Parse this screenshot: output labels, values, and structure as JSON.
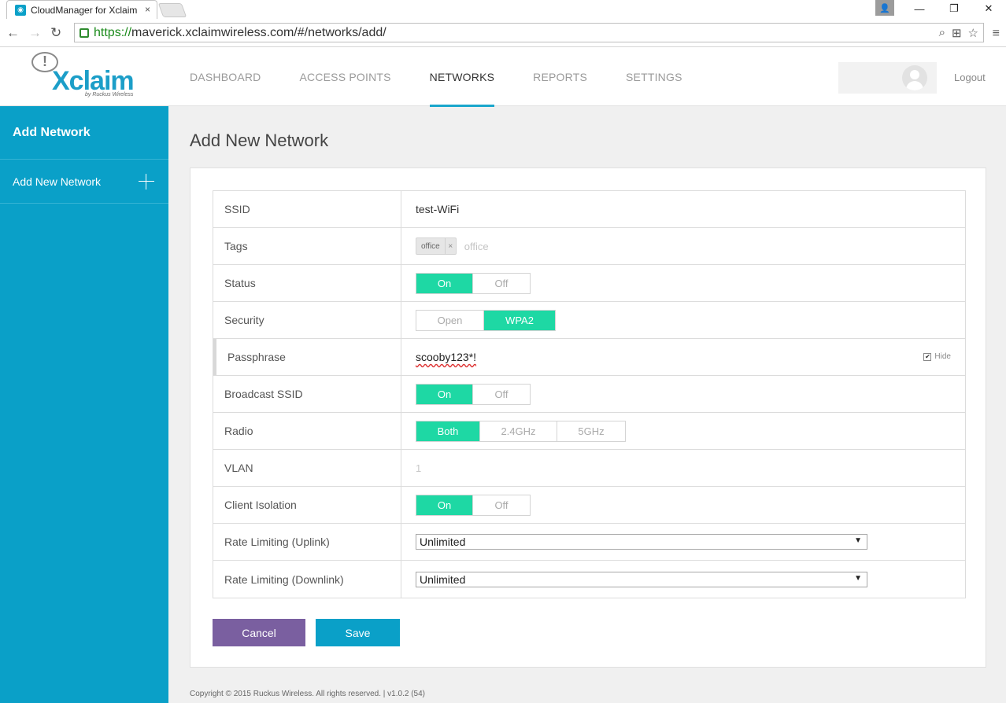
{
  "browser": {
    "tab_title": "CloudManager for Xclaim",
    "tab_close": "×",
    "url_scheme": "https://",
    "url_rest": "maverick.xclaimwireless.com/#/networks/add/",
    "window_buttons": [
      "—",
      "❐",
      "✕"
    ]
  },
  "header": {
    "logo_text": "Xclaim",
    "logo_tagline": "by Ruckus Wireless",
    "nav": [
      {
        "label": "DASHBOARD",
        "active": false
      },
      {
        "label": "ACCESS POINTS",
        "active": false
      },
      {
        "label": "NETWORKS",
        "active": true
      },
      {
        "label": "REPORTS",
        "active": false
      },
      {
        "label": "SETTINGS",
        "active": false
      }
    ],
    "logout": "Logout"
  },
  "sidebar": {
    "title": "Add Network",
    "items": [
      {
        "label": "Add New Network"
      }
    ]
  },
  "main": {
    "title": "Add New Network",
    "form": {
      "ssid": {
        "label": "SSID",
        "value": "test-WiFi"
      },
      "tags": {
        "label": "Tags",
        "chip": "office",
        "chip_remove": "×",
        "placeholder": "office"
      },
      "status": {
        "label": "Status",
        "options": [
          "On",
          "Off"
        ],
        "selected": "On"
      },
      "security": {
        "label": "Security",
        "options": [
          "Open",
          "WPA2"
        ],
        "selected": "WPA2"
      },
      "passphrase": {
        "label": "Passphrase",
        "value": "scooby123*!",
        "hide_label": "Hide",
        "hide_checked": true
      },
      "broadcast": {
        "label": "Broadcast SSID",
        "options": [
          "On",
          "Off"
        ],
        "selected": "On"
      },
      "radio": {
        "label": "Radio",
        "options": [
          "Both",
          "2.4GHz",
          "5GHz"
        ],
        "selected": "Both"
      },
      "vlan": {
        "label": "VLAN",
        "value": "1"
      },
      "isolation": {
        "label": "Client Isolation",
        "options": [
          "On",
          "Off"
        ],
        "selected": "On"
      },
      "uplink": {
        "label": "Rate Limiting (Uplink)",
        "value": "Unlimited"
      },
      "downlink": {
        "label": "Rate Limiting (Downlink)",
        "value": "Unlimited"
      }
    },
    "buttons": {
      "cancel": "Cancel",
      "save": "Save"
    }
  },
  "footer": "Copyright © 2015 Ruckus Wireless. All rights reserved. | v1.0.2 (54)",
  "colors": {
    "accent": "#0aa0c8",
    "toggle_on": "#1ed8a4",
    "cancel": "#7a5fa0"
  }
}
